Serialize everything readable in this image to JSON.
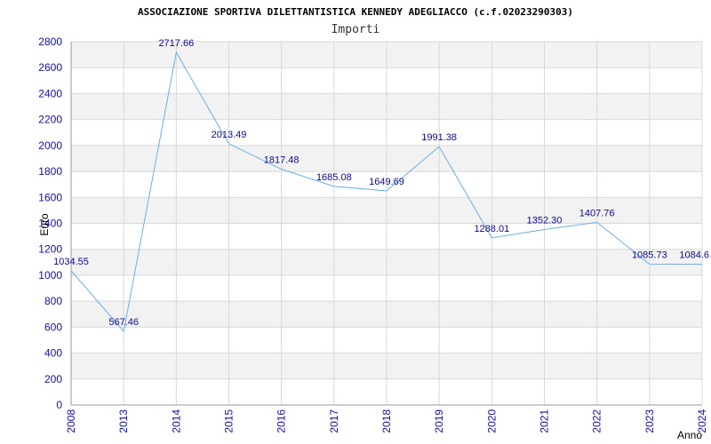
{
  "header": {
    "title": "ASSOCIAZIONE SPORTIVA DILETTANTISTICA KENNEDY ADEGLIACCO (c.f.02023290303)",
    "subtitle": "Importi"
  },
  "chart_data": {
    "type": "line",
    "title": "ASSOCIAZIONE SPORTIVA DILETTANTISTICA KENNEDY ADEGLIACCO (c.f.02023290303)",
    "subtitle": "Importi",
    "xlabel": "Anno",
    "ylabel": "Euro",
    "categories": [
      "2008",
      "2013",
      "2014",
      "2015",
      "2016",
      "2017",
      "2018",
      "2019",
      "2020",
      "2021",
      "2022",
      "2023",
      "2024"
    ],
    "series": [
      {
        "values": [
          1034.55,
          567.46,
          2717.66,
          2013.49,
          1817.48,
          1685.08,
          1649.69,
          1991.38,
          1288.01,
          1352.3,
          1407.76,
          1085.73,
          1084.6
        ],
        "labels": [
          "1034.55",
          "567.46",
          "2717.66",
          "2013.49",
          "1817.48",
          "1685.08",
          "1649.69",
          "1991.38",
          "1288.01",
          "1352.30",
          "1407.76",
          "1085.73",
          "1084.6"
        ]
      }
    ],
    "ylim": [
      0,
      2800
    ],
    "yticks": [
      0,
      200,
      400,
      600,
      800,
      1000,
      1200,
      1400,
      1600,
      1800,
      2000,
      2200,
      2400,
      2600,
      2800
    ],
    "grid": true,
    "colors": {
      "line": "#6aaee8",
      "band": "#f2f2f2",
      "grid": "#d8d8d8",
      "tick": "#1010a0",
      "label": "#0a0a8a"
    }
  }
}
